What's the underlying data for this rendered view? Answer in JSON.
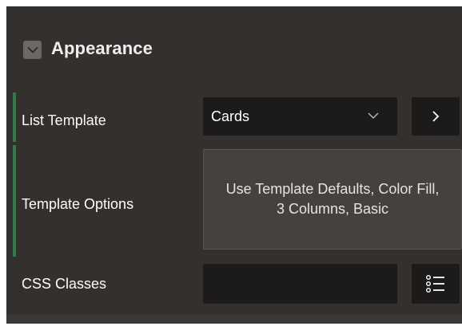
{
  "section": {
    "title": "Appearance",
    "toggle_icon": "chevron-down-icon"
  },
  "list_template": {
    "label": "List Template",
    "value": "Cards",
    "select_icon": "chevron-down-icon",
    "nav_icon": "chevron-right-icon"
  },
  "template_options": {
    "label": "Template Options",
    "value": "Use Template Defaults, Color Fill, 3 Columns, Basic"
  },
  "css_classes": {
    "label": "CSS Classes",
    "value": "",
    "list_icon": "list-icon"
  },
  "colors": {
    "panel_bg": "#34302d",
    "field_bg": "#1d1b1a",
    "accent_bar": "#2f7a47",
    "button_bg": "#45413e"
  }
}
